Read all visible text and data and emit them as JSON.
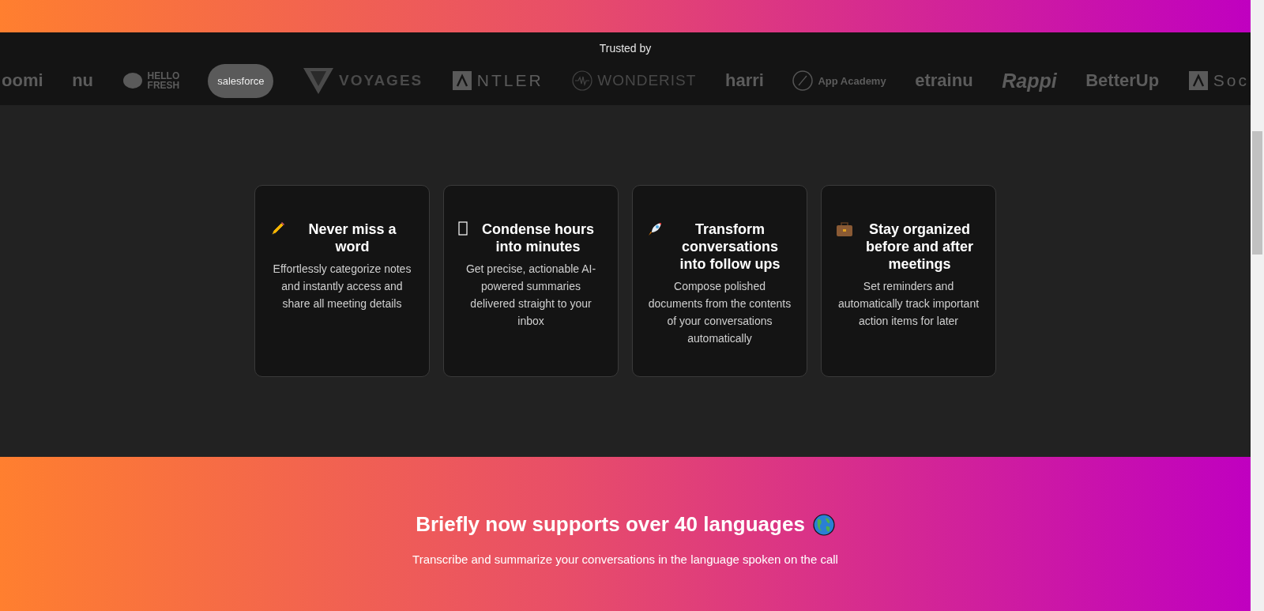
{
  "trusted_by": {
    "label": "Trusted by",
    "logos": [
      {
        "kind": "text",
        "text": "oomi"
      },
      {
        "kind": "text",
        "text": "nu"
      },
      {
        "kind": "leaf",
        "text": "HELLO FRESH"
      },
      {
        "kind": "cloud",
        "text": "salesforce"
      },
      {
        "kind": "chevron",
        "text": "VOYAGES"
      },
      {
        "kind": "boxed",
        "text": "NTLER"
      },
      {
        "kind": "wave",
        "text": "WONDERIST"
      },
      {
        "kind": "text",
        "text": "harri"
      },
      {
        "kind": "circle",
        "text": "App Academy"
      },
      {
        "kind": "text",
        "text": "etrainu"
      },
      {
        "kind": "script",
        "text": "Rappi"
      },
      {
        "kind": "text",
        "text": "BetterUp"
      },
      {
        "kind": "boxed",
        "text": "Soc"
      }
    ]
  },
  "features": [
    {
      "kind": "pencil",
      "title": "Never miss a word",
      "description": "Effortlessly categorize notes and instantly access and share all meeting details"
    },
    {
      "kind": "missing",
      "title": "Condense hours into minutes",
      "description": "Get precise, actionable AI-powered summaries delivered straight to your inbox"
    },
    {
      "kind": "rocket",
      "title": "Transform conversations into follow ups",
      "description": "Compose polished documents from the contents of your conversations automatically"
    },
    {
      "kind": "briefcase",
      "title": "Stay organized before and after meetings",
      "description": "Set reminders and automatically track important action items for later"
    }
  ],
  "languages": {
    "title": "Briefly now supports over 40 languages",
    "subtitle": "Transcribe and summarize your conversations in the language spoken on the call"
  }
}
